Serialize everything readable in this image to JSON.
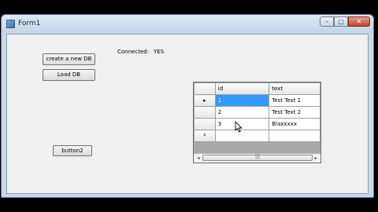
{
  "window": {
    "title": "Form1",
    "minimize_glyph": "–",
    "maximize_glyph": "□",
    "close_glyph": "✕"
  },
  "form": {
    "create_db_label": "create a new DB",
    "load_db_label": "Load DB",
    "button2_label": "button2",
    "connected_label": "Connected:",
    "connected_value": "YES"
  },
  "grid": {
    "columns": [
      "id",
      "text"
    ],
    "rows": [
      {
        "indicator": "▸",
        "id": "1",
        "text": "Test Text 1"
      },
      {
        "indicator": "",
        "id": "2",
        "text": "Test Text 2"
      },
      {
        "indicator": "",
        "id": "3",
        "text": "Blaxxxxx"
      }
    ],
    "new_row_indicator": "*",
    "scroll_left": "◂",
    "scroll_right": "▸",
    "thumb_grip": "|||"
  },
  "icons": [
    "app-icon",
    "minimize-icon",
    "maximize-icon",
    "close-icon",
    "row-pointer-icon",
    "mouse-cursor-icon"
  ]
}
